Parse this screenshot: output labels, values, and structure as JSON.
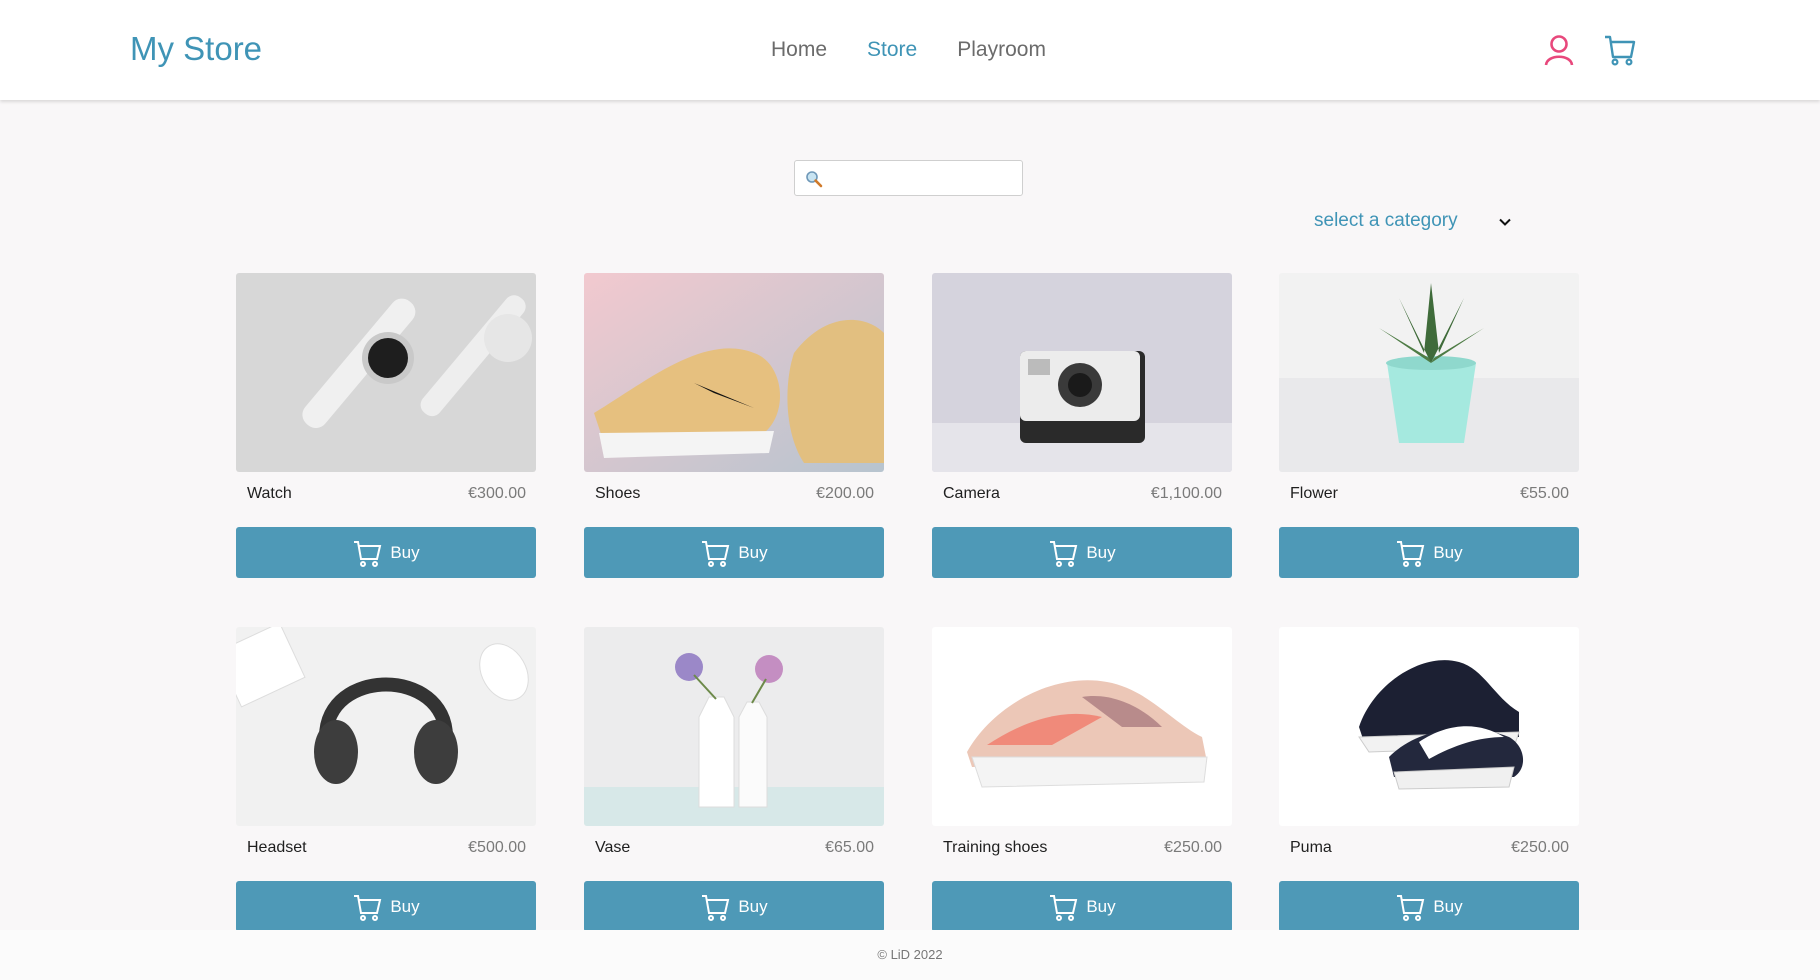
{
  "header": {
    "brand": "My Store",
    "nav": [
      {
        "label": "Home",
        "active": false
      },
      {
        "label": "Store",
        "active": true
      },
      {
        "label": "Playroom",
        "active": false
      }
    ],
    "icons": {
      "account": "user-icon",
      "cart": "cart-icon"
    },
    "colors": {
      "brand": "#3f94b6",
      "account_icon": "#e8487c"
    }
  },
  "search": {
    "icon": "search-icon",
    "value": "",
    "placeholder": ""
  },
  "category": {
    "selected": "select a category",
    "icon": "chevron-down-icon"
  },
  "products": [
    {
      "name": "Watch",
      "price": "€300.00",
      "buy_label": "Buy"
    },
    {
      "name": "Shoes",
      "price": "€200.00",
      "buy_label": "Buy"
    },
    {
      "name": "Camera",
      "price": "€1,100.00",
      "buy_label": "Buy"
    },
    {
      "name": "Flower",
      "price": "€55.00",
      "buy_label": "Buy"
    },
    {
      "name": "Headset",
      "price": "€500.00",
      "buy_label": "Buy"
    },
    {
      "name": "Vase",
      "price": "€65.00",
      "buy_label": "Buy"
    },
    {
      "name": "Training shoes",
      "price": "€250.00",
      "buy_label": "Buy"
    },
    {
      "name": "Puma",
      "price": "€250.00",
      "buy_label": "Buy"
    }
  ],
  "button_color": "#4e99b7",
  "footer": {
    "text": "© LiD 2022"
  }
}
